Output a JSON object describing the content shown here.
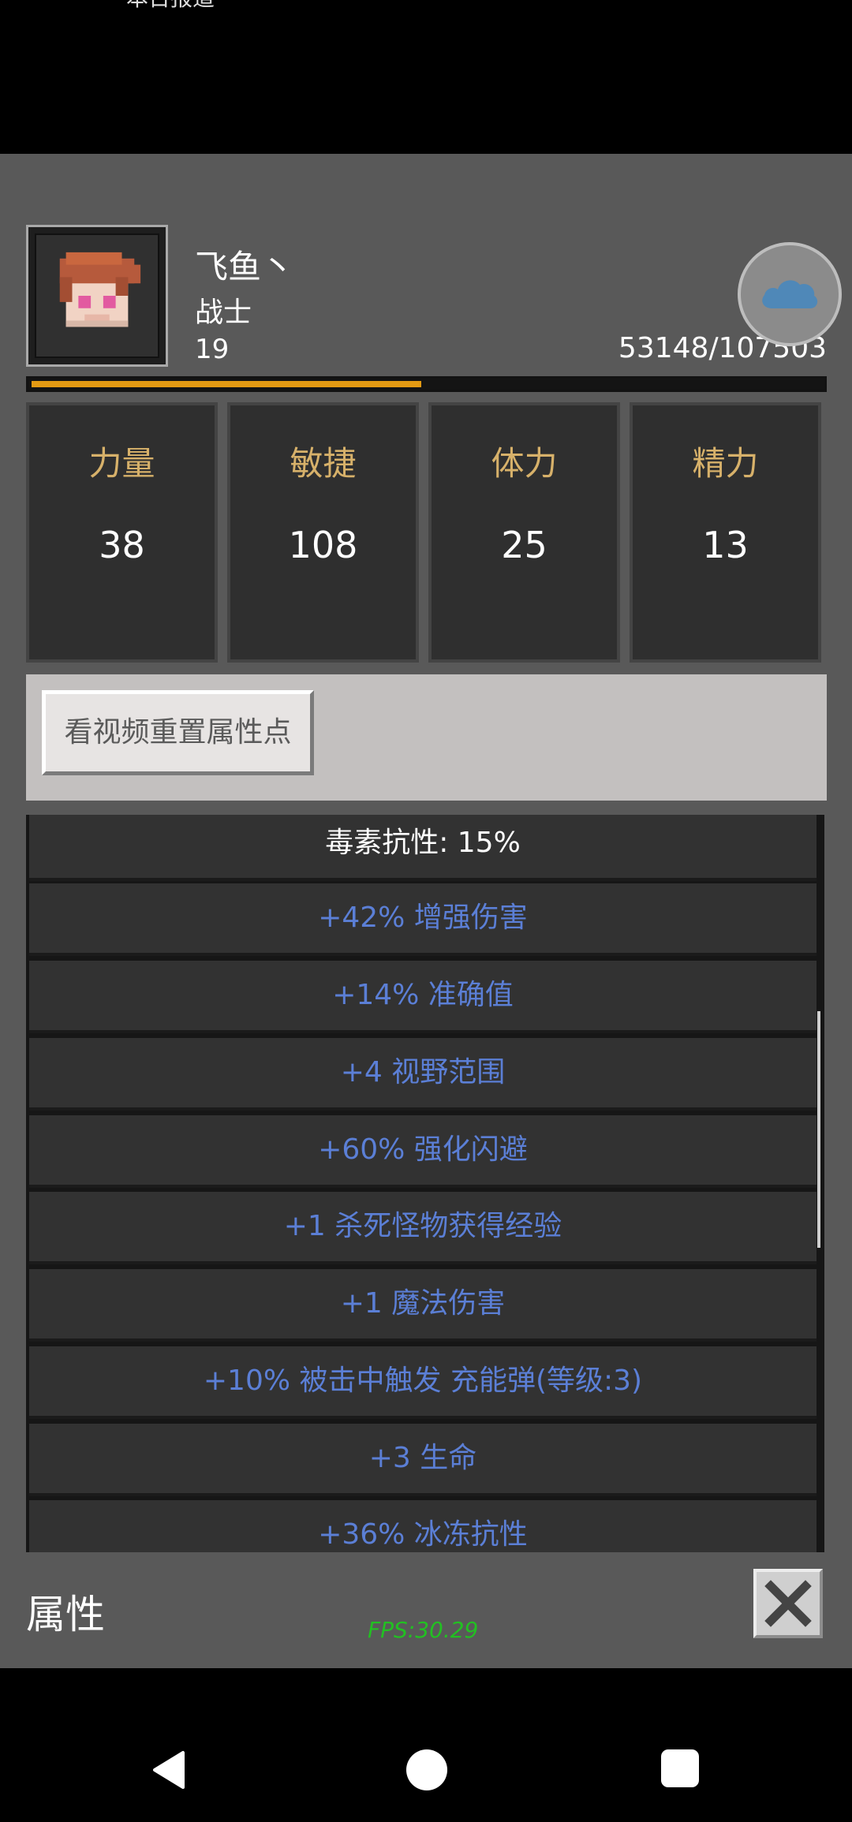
{
  "status_bar": {
    "partial_text": "本日报道"
  },
  "character": {
    "name": "飞鱼丶",
    "class": "战士",
    "level": "19",
    "exp_text": "53148/107503",
    "exp_progress": 0.494
  },
  "stats": [
    {
      "label": "力量",
      "value": "38"
    },
    {
      "label": "敏捷",
      "value": "108"
    },
    {
      "label": "体力",
      "value": "25"
    },
    {
      "label": "精力",
      "value": "13"
    }
  ],
  "reset_button_label": "看视频重置属性点",
  "attributes": [
    {
      "text": "毒素抗性: 15%",
      "color": "white"
    },
    {
      "text": "+42% 增强伤害",
      "color": "blue"
    },
    {
      "text": "+14% 准确值",
      "color": "blue"
    },
    {
      "text": "+4 视野范围",
      "color": "blue"
    },
    {
      "text": "+60% 强化闪避",
      "color": "blue"
    },
    {
      "text": "+1 杀死怪物获得经验",
      "color": "blue"
    },
    {
      "text": "+1 魔法伤害",
      "color": "blue"
    },
    {
      "text": "+10% 被击中触发 充能弹(等级:3)",
      "color": "blue"
    },
    {
      "text": "+3 生命",
      "color": "blue"
    },
    {
      "text": "+36% 冰冻抗性",
      "color": "blue"
    }
  ],
  "panel_title": "属性",
  "fps": "FPS:30.29",
  "colors": {
    "exp_bar": "#e39a13",
    "stat_label": "#d7b16a",
    "attribute_blue": "#5b7fd6",
    "fps": "#22c022"
  },
  "icons": {
    "cloud": "cloud-icon",
    "close": "close-icon",
    "back": "back-icon",
    "home": "home-icon",
    "recent": "recent-apps-icon"
  }
}
